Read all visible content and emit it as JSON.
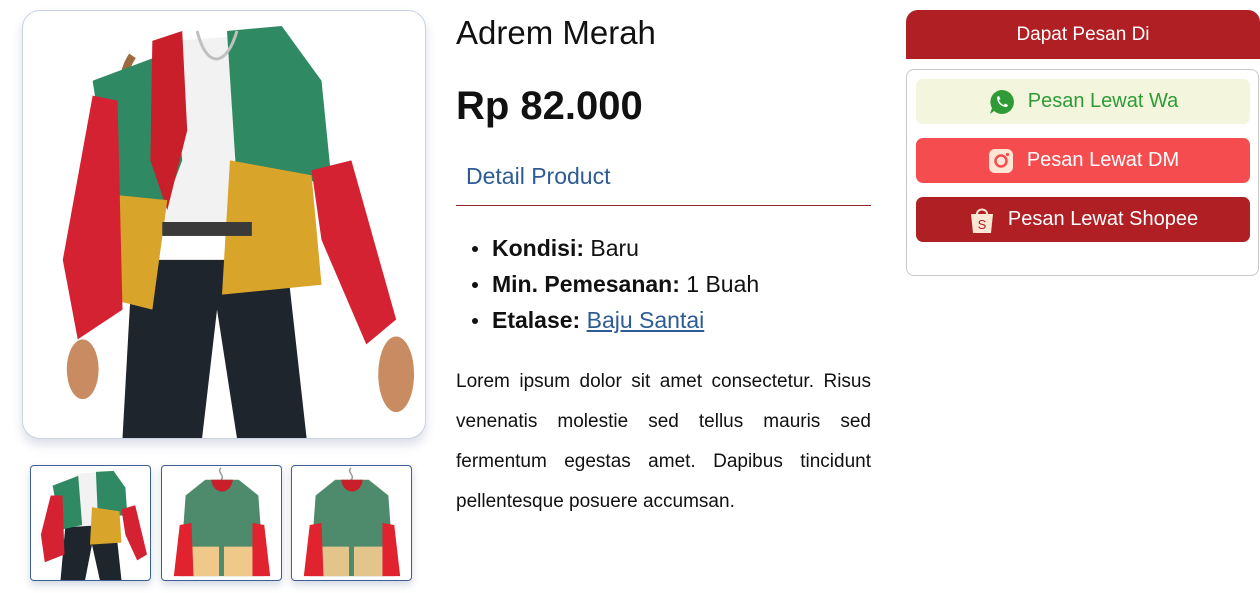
{
  "product": {
    "title": "Adrem Merah",
    "price": "Rp 82.000",
    "detail_tab": "Detail Product",
    "specs": [
      {
        "label": "Kondisi:",
        "value": "Baru"
      },
      {
        "label": "Min. Pemesanan:",
        "value": "1 Buah"
      },
      {
        "label": "Etalase:",
        "value": "Baju Santai"
      }
    ],
    "description": "Lorem ipsum dolor sit amet consectetur. Risus venenatis molestie sed tellus mauris sed fermentum egestas amet. Dapibus tincidunt pellentesque posuere accumsan."
  },
  "gallery": {
    "main_icon": "jacket-photo",
    "thumbnails": [
      "jacket-worn-photo",
      "jacket-hanger-photo",
      "jacket-hanger-photo"
    ]
  },
  "order": {
    "heading": "Dapat Pesan Di",
    "buttons": [
      {
        "label": "Pesan Lewat Wa",
        "icon": "whatsapp-icon"
      },
      {
        "label": "Pesan Lewat DM",
        "icon": "instagram-icon"
      },
      {
        "label": "Pesan Lewat Shopee",
        "icon": "shopee-bag-icon"
      }
    ]
  },
  "colors": {
    "brand_red": "#b01f23",
    "dm_red": "#f44c4f",
    "wa_green": "#2e9b37",
    "wa_bg": "#f3f5dc",
    "link_blue": "#2d5b95"
  }
}
